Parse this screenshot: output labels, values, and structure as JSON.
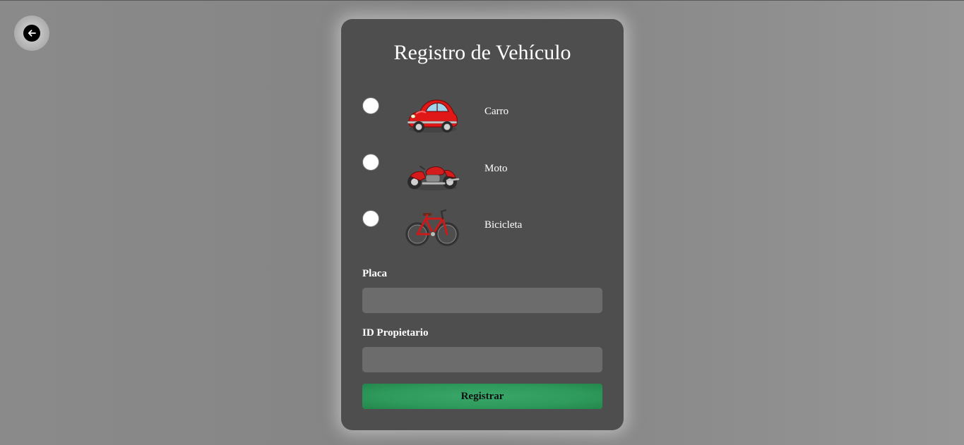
{
  "back_button": {
    "icon": "arrow-left-icon"
  },
  "form": {
    "title": "Registro de Vehículo",
    "options": [
      {
        "label": "Carro",
        "icon": "car-icon",
        "color": "#e01818"
      },
      {
        "label": "Moto",
        "icon": "motorcycle-icon",
        "color": "#d41c1c"
      },
      {
        "label": "Bicicleta",
        "icon": "bicycle-icon",
        "color": "#cc1a1a"
      }
    ],
    "placa": {
      "label": "Placa",
      "value": "",
      "placeholder": ""
    },
    "id_propietario": {
      "label": "ID Propietario",
      "value": "",
      "placeholder": ""
    },
    "submit_label": "Registrar"
  },
  "colors": {
    "card_bg": "#4e4e4e",
    "input_bg": "#6c6c6c",
    "button_green": "#2e9a5c"
  }
}
